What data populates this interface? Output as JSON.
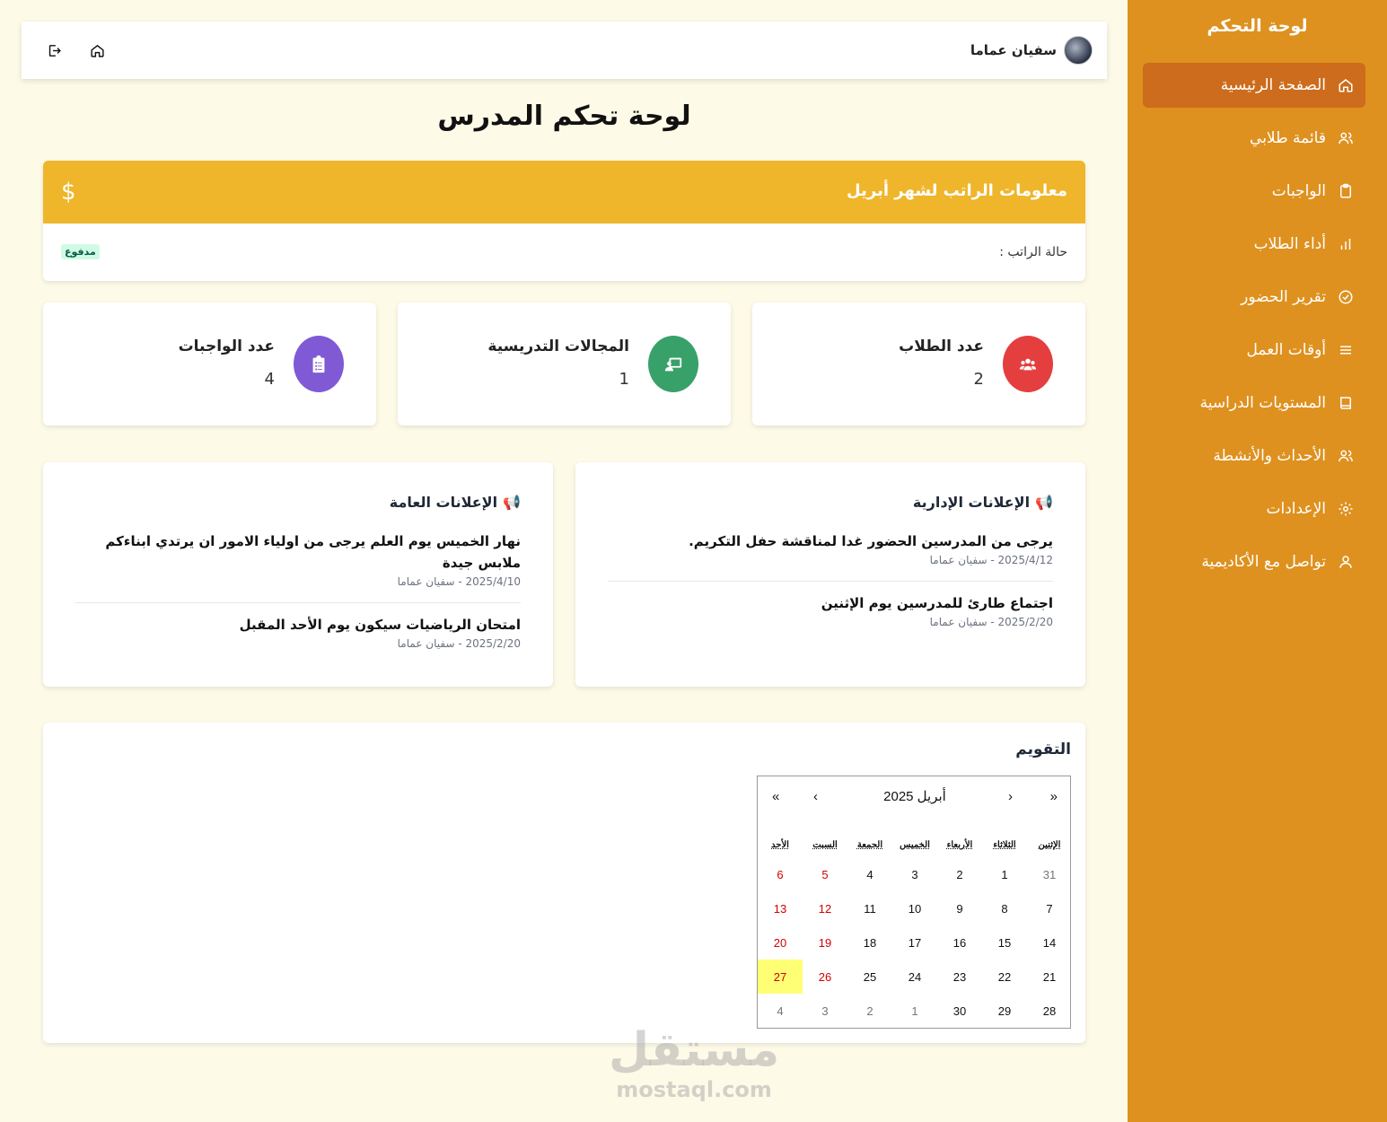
{
  "sidebar": {
    "title": "لوحة التحكم",
    "items": [
      {
        "label": "الصفحة الرئيسية",
        "icon": "home-icon",
        "active": true
      },
      {
        "label": "قائمة طلابي",
        "icon": "users-icon"
      },
      {
        "label": "الواجبات",
        "icon": "clipboard-icon"
      },
      {
        "label": "أداء الطلاب",
        "icon": "bar-chart-icon"
      },
      {
        "label": "تقرير الحضور",
        "icon": "check-circle-icon"
      },
      {
        "label": "أوقات العمل",
        "icon": "menu-icon"
      },
      {
        "label": "المستويات الدراسية",
        "icon": "book-icon"
      },
      {
        "label": "الأحداث والأنشطة",
        "icon": "users-icon"
      },
      {
        "label": "الإعدادات",
        "icon": "gear-icon"
      },
      {
        "label": "تواصل مع الأكاديمية",
        "icon": "user-icon"
      }
    ]
  },
  "header": {
    "user_name": "سفيان عماما"
  },
  "page_title": "لوحة تحكم المدرس",
  "salary": {
    "title": "معلومات الراتب لشهر أبريل",
    "status_label": "حالة الراتب :",
    "status_badge": "مدفوع"
  },
  "stats": [
    {
      "label": "عدد الطلاب",
      "value": "2",
      "color": "#e53e3e",
      "icon": "users-icon"
    },
    {
      "label": "المجالات التدريسية",
      "value": "1",
      "color": "#38a169",
      "icon": "teacher-icon"
    },
    {
      "label": "عدد الواجبات",
      "value": "4",
      "color": "#805ad5",
      "icon": "clipboard-list-icon"
    }
  ],
  "admin_announcements": {
    "title": "الإعلانات الإدارية",
    "items": [
      {
        "text": "يرجى من المدرسين الحضور غدا لمناقشة حفل التكريم.",
        "meta": "2025/4/12 - سفيان عماما"
      },
      {
        "text": "اجتماع طارئ للمدرسين يوم الإثنين",
        "meta": "2025/2/20 - سفيان عماما"
      }
    ]
  },
  "general_announcements": {
    "title": "الإعلانات العامة",
    "items": [
      {
        "text": "نهار الخميس يوم العلم يرجى من اولياء الامور ان يرتدي ابناءكم ملابس جيدة",
        "meta": "2025/4/10 - سفيان عماما"
      },
      {
        "text": "امتحان الرياضيات سيكون يوم الأحد المقبل",
        "meta": "2025/2/20 - سفيان عماما"
      }
    ]
  },
  "calendar": {
    "title": "التقويم",
    "month_label": "أبريل 2025",
    "nav": {
      "prev_year": "«",
      "prev_month": "‹",
      "next_month": "›",
      "next_year": "»"
    },
    "weekdays": [
      "الإثنين",
      "الثلاثاء",
      "الأربعاء",
      "الخميس",
      "الجمعة",
      "السبت",
      "الأحد"
    ],
    "weeks": [
      [
        "31",
        "1",
        "2",
        "3",
        "4",
        "5",
        "6"
      ],
      [
        "7",
        "8",
        "9",
        "10",
        "11",
        "12",
        "13"
      ],
      [
        "14",
        "15",
        "16",
        "17",
        "18",
        "19",
        "20"
      ],
      [
        "21",
        "22",
        "23",
        "24",
        "25",
        "26",
        "27"
      ],
      [
        "28",
        "29",
        "30",
        "1",
        "2",
        "3",
        "4"
      ]
    ],
    "today": "27"
  },
  "watermark": {
    "arabic": "مستقل",
    "latin": "mostaql.com"
  }
}
